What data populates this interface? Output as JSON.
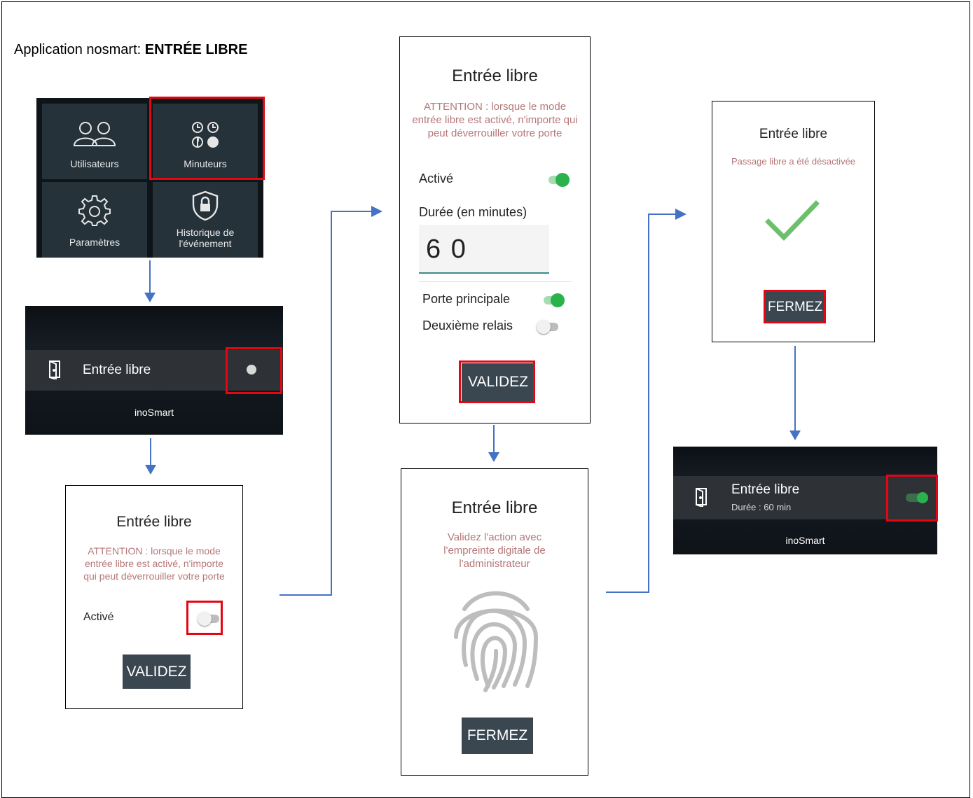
{
  "title": {
    "prefix": "Application nosmart: ",
    "bold": "ENTRÉE LIBRE"
  },
  "menu": {
    "tiles": [
      {
        "label": "Utilisateurs",
        "icon": "users-icon"
      },
      {
        "label": "Minuteurs",
        "icon": "timers-icon"
      },
      {
        "label": "Paramètres",
        "icon": "gear-icon"
      },
      {
        "label": "Historique de l'événement",
        "icon": "shield-lock-icon"
      }
    ]
  },
  "list_panel_off": {
    "item_label": "Entrée libre",
    "brand": "inoSmart",
    "toggle_state": "off"
  },
  "dialog_step1": {
    "title": "Entrée libre",
    "warning": "ATTENTION : lorsque le mode entrée libre est activé, n'importe qui peut déverrouiller votre porte",
    "active_label": "Activé",
    "active_state": "off",
    "button": "VALIDEZ"
  },
  "dialog_step2": {
    "title": "Entrée libre",
    "warning": "ATTENTION : lorsque le mode entrée libre est activé, n'importe qui peut déverrouiller votre porte",
    "active_label": "Activé",
    "active_state": "on",
    "duration_label": "Durée (en minutes)",
    "duration_value": "6 0",
    "relay1_label": "Porte principale",
    "relay1_state": "on",
    "relay2_label": "Deuxième relais",
    "relay2_state": "off",
    "button": "VALIDEZ"
  },
  "dialog_fingerprint": {
    "title": "Entrée libre",
    "message": "Validez l'action avec l'empreinte digitale de l'administrateur",
    "icon": "fingerprint-icon",
    "button": "FERMEZ"
  },
  "dialog_done": {
    "title": "Entrée libre",
    "message": "Passage libre a été désactivée",
    "icon": "checkmark-icon",
    "button": "FERMEZ"
  },
  "list_panel_on": {
    "item_label": "Entrée libre",
    "item_sub": "Durée : 60 min",
    "brand": "inoSmart",
    "toggle_state": "on"
  },
  "colors": {
    "highlight": "#e30613",
    "arrow": "#4472c4",
    "accent_green": "#2bb24c",
    "warning_text": "#b57778",
    "button_bg": "#3a4650"
  }
}
